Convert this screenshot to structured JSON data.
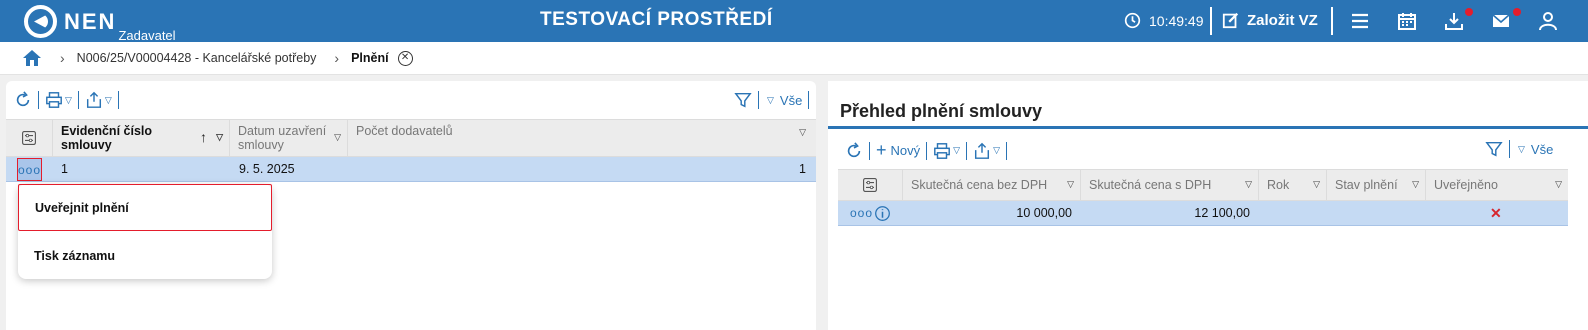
{
  "header": {
    "logo_text": "NEN",
    "logo_sub": "Zadavatel",
    "env_title": "TESTOVACÍ PROSTŘEDÍ",
    "time": "10:49:49",
    "new_vz_label": "Založit VZ",
    "accent": "#2a74b5",
    "notification_color": "#e41d2c"
  },
  "breadcrumb": {
    "items": [
      "N006/25/V00004428 - Kancelářské potřeby",
      "Plnění"
    ]
  },
  "left_grid": {
    "filter_label": "Vše",
    "columns": [
      "Evidenční číslo smlouvy",
      "Datum uzavření smlouvy",
      "Počet dodavatelů"
    ],
    "rows": [
      {
        "evidencni_cislo": "1",
        "datum": "9. 5. 2025",
        "pocet": "1"
      }
    ],
    "context_menu": [
      "Uveřejnit plnění",
      "Tisk záznamu"
    ]
  },
  "right_panel": {
    "title": "Přehled plnění smlouvy",
    "new_label": "Nový",
    "filter_label": "Vše",
    "columns": [
      "Skutečná cena bez DPH",
      "Skutečná cena s DPH",
      "Rok",
      "Stav plnění",
      "Uveřejněno"
    ],
    "rows": [
      {
        "cena_bez_dph": "10 000,00",
        "cena_s_dph": "12 100,00",
        "rok": "",
        "stav": "",
        "uverejneno_icon": "red-x-icon"
      }
    ]
  }
}
